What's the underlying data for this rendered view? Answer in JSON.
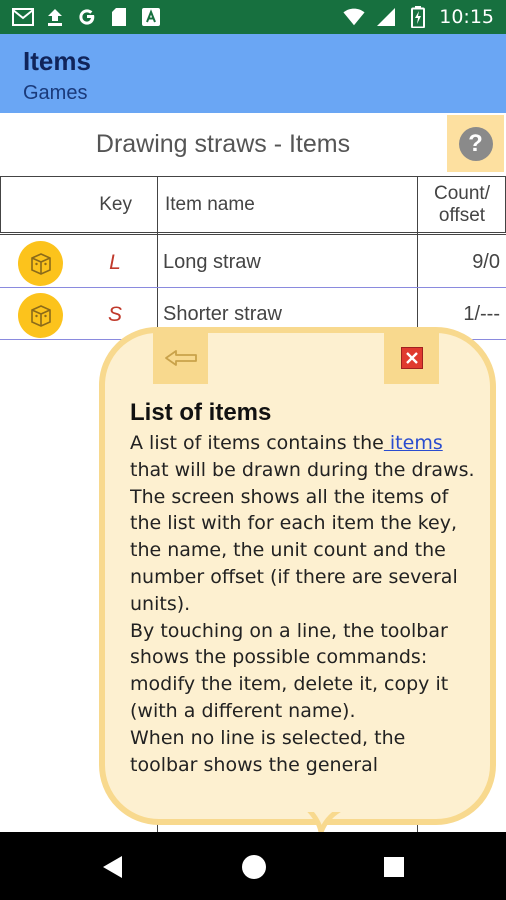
{
  "status_bar": {
    "time": "10:15",
    "left_icons": [
      "gmail-icon",
      "upload-icon",
      "google-icon",
      "sd-card-icon",
      "font-icon"
    ],
    "right_icons": [
      "wifi-icon",
      "signal-icon",
      "battery-charging-icon"
    ]
  },
  "app_bar": {
    "title": "Items",
    "subtitle": "Games",
    "color": "#6aa6f4"
  },
  "list": {
    "title": "Drawing straws - Items",
    "help_label": "?"
  },
  "table": {
    "headers": {
      "key": "Key",
      "name": "Item name",
      "count_line1": "Count/",
      "count_line2": "offset"
    },
    "rows": [
      {
        "icon": "dice-box-icon",
        "key": "L",
        "name": "Long straw",
        "count": "9/0"
      },
      {
        "icon": "dice-box-icon",
        "key": "S",
        "name": "Shorter straw",
        "count": "1/---"
      }
    ]
  },
  "help_bubble": {
    "title": "List of items",
    "intro_before_link": "A list of items contains the",
    "link_text": " items",
    "intro_after_link": " that will be drawn during the draws.",
    "para2": "The screen shows all the items of the list with for each item the key, the name, the unit count and the number offset (if there are several units).",
    "para3": "By touching on a line, the toolbar shows the possible commands: modify the item, delete it, copy it (with a different name).",
    "para4": "When no line is selected, the toolbar shows the general",
    "back_icon": "back-arrow-icon",
    "close_icon": "close-icon"
  },
  "nav_bar": {
    "buttons": [
      "back-triangle-icon",
      "home-circle-icon",
      "recents-square-icon"
    ]
  }
}
